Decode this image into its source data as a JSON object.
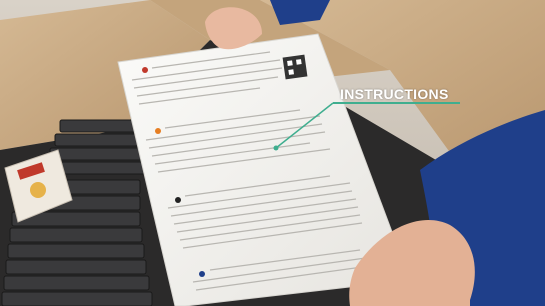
{
  "callout": {
    "label": "INSTRUCTIONS",
    "line_color": "#3fae8f"
  },
  "colors": {
    "cardboard": "#c9ab86",
    "cardboard_shadow": "#8f7452",
    "box_interior": "#2b2a2a",
    "sleeve": "#1f3f8a",
    "paper": "#f2f1ee"
  }
}
